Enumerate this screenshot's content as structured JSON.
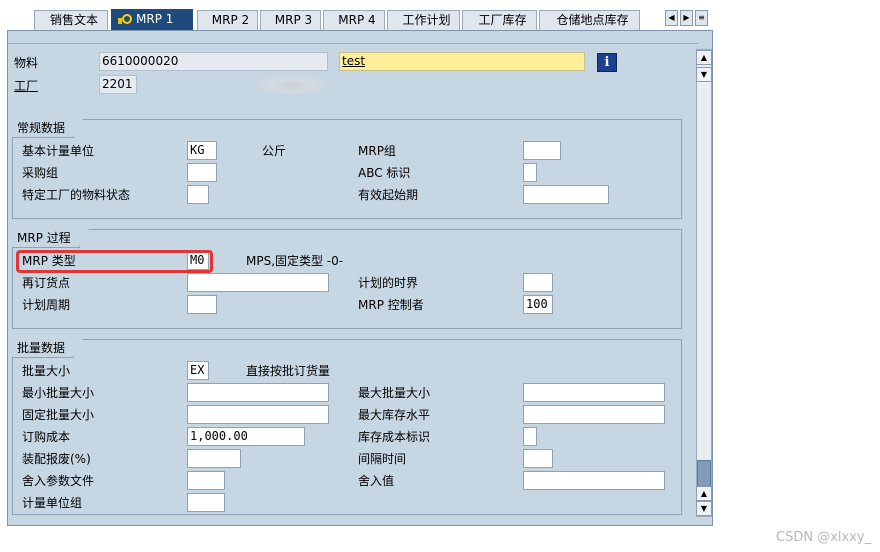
{
  "tabs": [
    "销售文本",
    "MRP 1",
    "MRP 2",
    "MRP 3",
    "MRP 4",
    "工作计划",
    "工厂库存",
    "仓储地点库存"
  ],
  "header": {
    "material_label": "物料",
    "material_value": "6610000020",
    "material_desc": "test",
    "plant_label": "工厂",
    "plant_value": "2201"
  },
  "general": {
    "title": "常规数据",
    "base_uom_label": "基本计量单位",
    "base_uom_value": "KG",
    "base_uom_text": "公斤",
    "purch_group_label": "采购组",
    "plant_status_label": "特定工厂的物料状态",
    "mrp_group_label": "MRP组",
    "abc_label": "ABC 标识",
    "valid_from_label": "有效起始期"
  },
  "mrp": {
    "title": "MRP 过程",
    "mrp_type_label": "MRP 类型",
    "mrp_type_value": "M0",
    "mrp_type_text": "MPS,固定类型 -0-",
    "reorder_label": "再订货点",
    "planning_cycle_label": "计划周期",
    "time_fence_label": "计划的时界",
    "controller_label": "MRP 控制者",
    "controller_value": "100"
  },
  "lot": {
    "title": "批量数据",
    "lot_size_label": "批量大小",
    "lot_size_value": "EX",
    "lot_size_text": "直接按批订货量",
    "min_lot_label": "最小批量大小",
    "fixed_lot_label": "固定批量大小",
    "order_cost_label": "订购成本",
    "order_cost_value": "1,000.00",
    "assembly_scrap_label": "装配报废(%)",
    "rounding_profile_label": "舍入参数文件",
    "uom_group_label": "计量单位组",
    "max_lot_label": "最大批量大小",
    "max_stock_label": "最大库存水平",
    "storage_cost_label": "库存成本标识",
    "takt_time_label": "间隔时间",
    "rounding_value_label": "舍入值"
  },
  "watermark": "CSDN @xlxxy_",
  "colors": {
    "active_tab": "#1f4a7c",
    "highlight_box": "#e23636",
    "desc_field": "#ffee99",
    "background": "#c7d6e3"
  }
}
